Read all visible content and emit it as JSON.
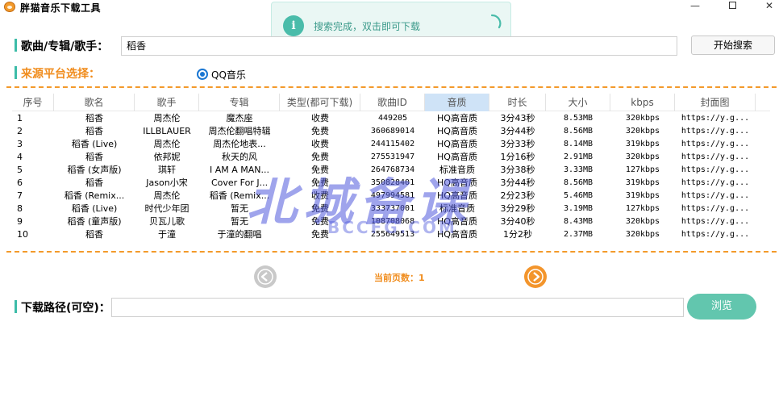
{
  "window": {
    "title": "胖猫音乐下载工具",
    "minimize": "—",
    "close": "✕"
  },
  "toast": {
    "icon": "i",
    "message": "搜索完成，双击即可下载"
  },
  "search": {
    "label": "歌曲/专辑/歌手：",
    "value": "稻香",
    "button": "开始搜索"
  },
  "platform": {
    "label": "来源平台选择：",
    "option": "QQ音乐"
  },
  "table": {
    "columns": [
      "序号",
      "歌名",
      "歌手",
      "专辑",
      "类型(都可下载)",
      "歌曲ID",
      "音质",
      "时长",
      "大小",
      "kbps",
      "封面图"
    ],
    "active_column": "音质",
    "rows": [
      [
        "1",
        "稻香",
        "周杰伦",
        "魔杰座",
        "收费",
        "449205",
        "HQ高音质",
        "3分43秒",
        "8.53MB",
        "320kbps",
        "https://y.g..."
      ],
      [
        "2",
        "稻香",
        "ILLBLAUER",
        "周杰伦翻唱特辑",
        "免费",
        "360689014",
        "HQ高音质",
        "3分44秒",
        "8.56MB",
        "320kbps",
        "https://y.g..."
      ],
      [
        "3",
        "稻香 (Live)",
        "周杰伦",
        "周杰伦地表...",
        "收费",
        "244115402",
        "HQ高音质",
        "3分33秒",
        "8.14MB",
        "319kbps",
        "https://y.g..."
      ],
      [
        "4",
        "稻香",
        "依邦妮",
        "秋天的风",
        "免费",
        "275531947",
        "HQ高音质",
        "1分16秒",
        "2.91MB",
        "320kbps",
        "https://y.g..."
      ],
      [
        "5",
        "稻香 (女声版)",
        "琪轩",
        "I AM A MAN...",
        "免费",
        "264768734",
        "标准音质",
        "3分38秒",
        "3.33MB",
        "127kbps",
        "https://y.g..."
      ],
      [
        "6",
        "稻香",
        "Jason小宋",
        "Cover For J...",
        "免费",
        "350828401",
        "HQ高音质",
        "3分44秒",
        "8.56MB",
        "319kbps",
        "https://y.g..."
      ],
      [
        "7",
        "稻香 (Remix...",
        "周杰伦",
        "稻香 (Remix...",
        "收费",
        "497994581",
        "HQ高音质",
        "2分23秒",
        "5.46MB",
        "319kbps",
        "https://y.g..."
      ],
      [
        "8",
        "稻香 (Live)",
        "时代少年团",
        "暂无",
        "免费",
        "333737001",
        "标准音质",
        "3分29秒",
        "3.19MB",
        "127kbps",
        "https://y.g..."
      ],
      [
        "9",
        "稻香 (童声版)",
        "贝瓦儿歌",
        "暂无",
        "免费",
        "108708068",
        "HQ高音质",
        "3分40秒",
        "8.43MB",
        "320kbps",
        "https://y.g..."
      ],
      [
        "10",
        "稻香",
        "于潼",
        "于潼的翻唱",
        "免费",
        "255649513",
        "HQ高音质",
        "1分2秒",
        "2.37MB",
        "320kbps",
        "https://y.g..."
      ]
    ]
  },
  "pager": {
    "label": "当前页数：1"
  },
  "download": {
    "label": "下载路径(可空)：",
    "value": "",
    "button": "浏览"
  },
  "watermark": {
    "main": "北城备课",
    "sub": "BCCFG.COM"
  },
  "colors": {
    "accent": "#3cbca8",
    "orange": "#f08c1c",
    "browse_button": "#62c6ae",
    "radio": "#1976d2"
  },
  "icons": {
    "app": "cat-icon",
    "toast": "info-icon",
    "spinner": "loading-icon",
    "prev": "arrow-left-icon",
    "next": "arrow-right-icon"
  }
}
